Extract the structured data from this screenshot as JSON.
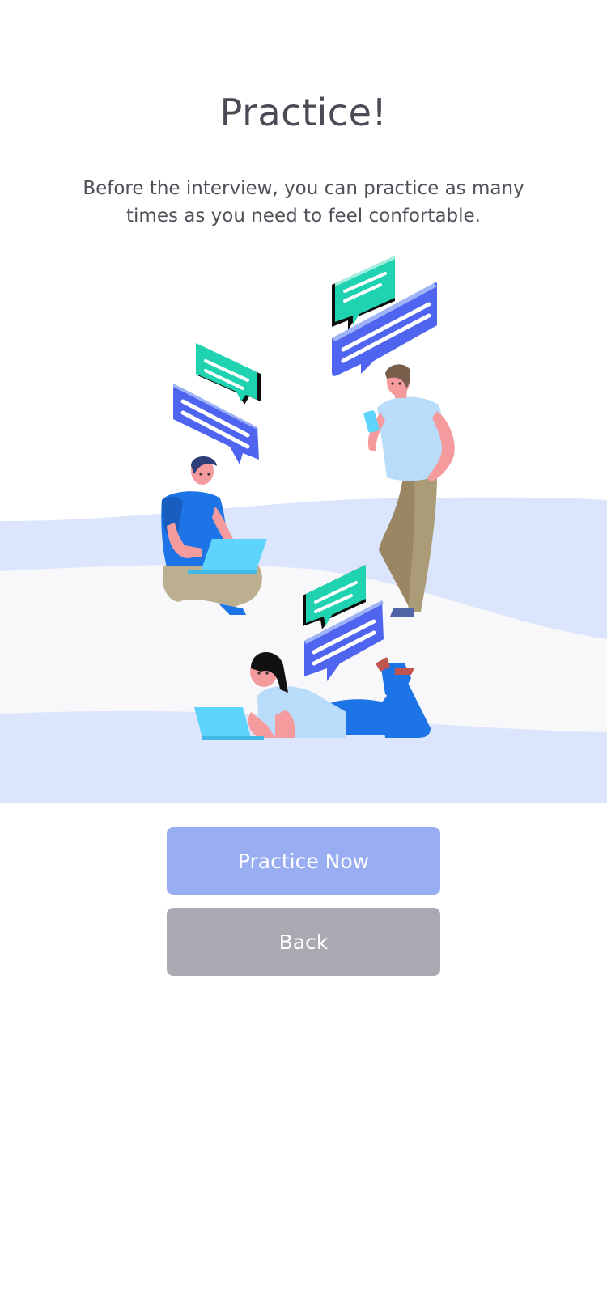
{
  "header": {
    "title": "Practice!",
    "subtitle": "Before the interview, you can practice as many times as you need to feel confortable."
  },
  "illustration": {
    "icon": "people-chatting-illustration",
    "colors": {
      "background_wave": "#dbe5fb",
      "floor": "#f8f8fa",
      "bubble_blue": "#4f65f0",
      "bubble_green": "#1fd3b0",
      "laptop": "#5ed3fb"
    }
  },
  "actions": {
    "practice_now_label": "Practice Now",
    "back_label": "Back"
  },
  "colors": {
    "primary_button": "#99aef2",
    "secondary_button": "#aaa9b1",
    "title_text": "#4a4b55",
    "body_text": "#4f5058"
  }
}
